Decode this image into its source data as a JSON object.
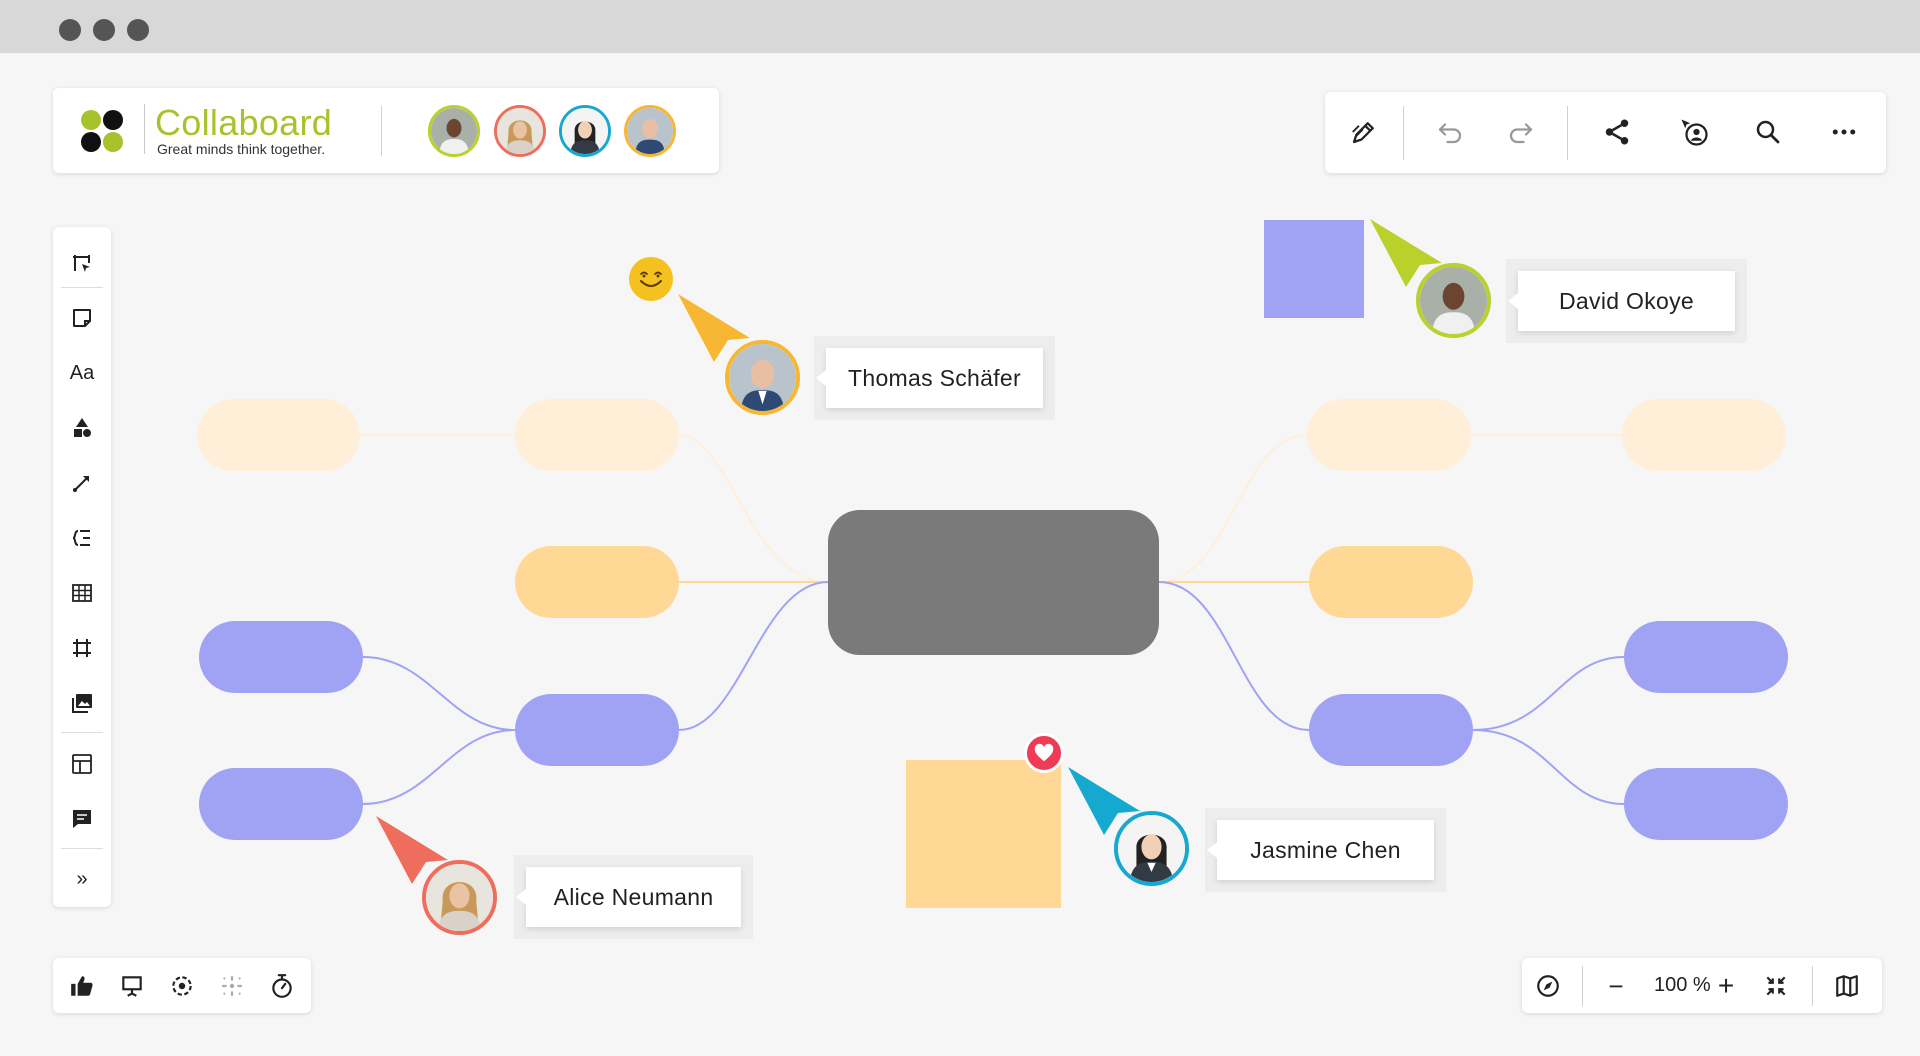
{
  "app": {
    "name": "Collaboard",
    "tagline": "Great minds think together.",
    "brand_color": "#a8c22c"
  },
  "header": {
    "participants": [
      {
        "name": "David Okoye",
        "ring": "#b9d12a",
        "skin": "#6b4530",
        "shirt": "#f0f0f0"
      },
      {
        "name": "Alice Neumann",
        "ring": "#ef6d5c",
        "skin": "#e8c3a4",
        "shirt": "#d8d2c8"
      },
      {
        "name": "Jasmine Chen",
        "ring": "#16a9cf",
        "skin": "#f0d1b6",
        "shirt": "#333a44"
      },
      {
        "name": "Thomas Schäfer",
        "ring": "#f7b733",
        "skin": "#e9bfa3",
        "shirt": "#2e4a74"
      }
    ]
  },
  "toolbar": {
    "icons": [
      "pen-icon",
      "undo-icon",
      "redo-icon",
      "share-icon",
      "follow-user-icon",
      "search-icon",
      "more-icon"
    ]
  },
  "left_tools": {
    "icons": [
      "select-icon",
      "sticky-note-icon",
      "text-icon",
      "shapes-icon",
      "connector-icon",
      "mindmap-icon",
      "table-icon",
      "frame-icon",
      "image-icon",
      "template-icon",
      "comment-icon",
      "expand-icon"
    ],
    "text_label": "Aa",
    "expand_label": "»"
  },
  "bottom_left": {
    "icons": [
      "like-icon",
      "presentation-icon",
      "focus-icon",
      "attention-icon",
      "timer-icon"
    ]
  },
  "bottom_right": {
    "zoom_label": "100 %",
    "zoom_out_label": "−",
    "zoom_in_label": "+",
    "icons": [
      "navigate-icon",
      "zoom-out-icon",
      "zoom-in-icon",
      "fit-icon",
      "minimap-icon"
    ]
  },
  "cursors": [
    {
      "name": "Thomas Schäfer",
      "color": "#f7b733"
    },
    {
      "name": "David Okoye",
      "color": "#b9d12a"
    },
    {
      "name": "Jasmine Chen",
      "color": "#16a9cf"
    },
    {
      "name": "Alice Neumann",
      "color": "#ef6d5c"
    }
  ],
  "colors": {
    "node_light": "#ffefd8",
    "node_orange": "#ffd896",
    "node_purple": "#a0a3f3",
    "center_node": "#7a7a7a",
    "sticky_purple": "#a0a3f3",
    "sticky_orange": "#ffd896",
    "reaction_heart": "#ef3b55",
    "reaction_smile": "#f5c11e"
  }
}
